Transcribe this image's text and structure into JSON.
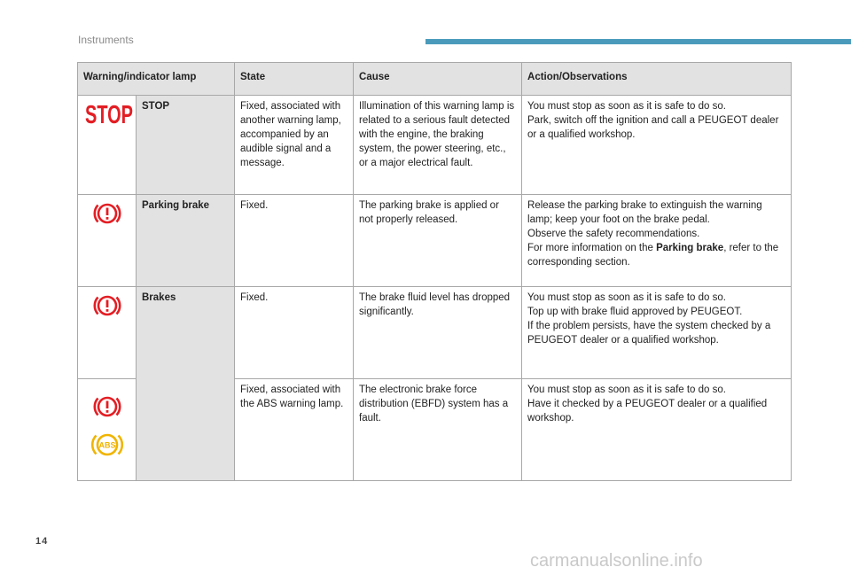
{
  "header": {
    "section_title": "Instruments"
  },
  "footer": {
    "page_number": "14",
    "watermark": "carmanualsonline.info"
  },
  "colors": {
    "header_bar": "#4a9bbb",
    "stop_red": "#e31e24",
    "warning_red": "#e31e24",
    "abs_amber": "#f0b400",
    "table_header_bg": "#e2e2e2"
  },
  "table": {
    "headers": {
      "lamp": "Warning/indicator lamp",
      "state": "State",
      "cause": "Cause",
      "action": "Action/Observations"
    },
    "rows": [
      {
        "icon": "stop-icon",
        "icon_text": "STOP",
        "name": "STOP",
        "state": "Fixed, associated with another warning lamp, accompanied by an audible signal and a message.",
        "cause": "Illumination of this warning lamp is related to a serious fault detected with the engine, the braking system, the power steering, etc., or a major electrical fault.",
        "action": [
          "You must stop as soon as it is safe to do so.",
          "Park, switch off the ignition and call a PEUGEOT dealer or a qualified workshop."
        ]
      },
      {
        "icon": "brake-warning-icon",
        "name": "Parking brake",
        "state": "Fixed.",
        "cause": "The parking brake is applied or not properly released.",
        "action": [
          "Release the parking brake to extinguish the warning lamp; keep your foot on the brake pedal.",
          "Observe the safety recommendations."
        ],
        "action_more_prefix": "For more information on the ",
        "action_more_bold": "Parking brake",
        "action_more_suffix": ", refer to the corresponding section."
      },
      {
        "icon": "brake-warning-icon",
        "name": "Brakes",
        "state": "Fixed.",
        "cause": "The brake fluid level has dropped significantly.",
        "action": [
          "You must stop as soon as it is safe to do so.",
          "Top up with brake fluid approved by PEUGEOT.",
          "If the problem persists, have the system checked by a PEUGEOT dealer or a qualified workshop."
        ]
      },
      {
        "icons": [
          "brake-warning-icon",
          "abs-icon"
        ],
        "abs_text": "ABS",
        "state": "Fixed, associated with the ABS warning lamp.",
        "cause": "The electronic brake force distribution (EBFD) system has a fault.",
        "action": [
          "You must stop as soon as it is safe to do so.",
          "Have it checked by a PEUGEOT dealer or a qualified workshop."
        ]
      }
    ]
  }
}
